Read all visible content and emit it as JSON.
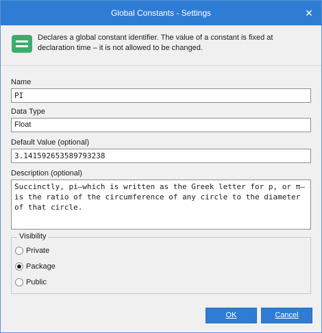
{
  "window": {
    "title": "Global Constants - Settings",
    "close_glyph": "✕"
  },
  "info": {
    "icon": "constant-icon",
    "icon_color": "#3cae6c",
    "text": "Declares a global constant identifier. The value of a constant is fixed at declaration time – it is not allowed to be changed."
  },
  "form": {
    "name_label": "Name",
    "name_value": "PI",
    "data_type_label": "Data Type",
    "data_type_value": "Float",
    "default_label": "Default Value (optional)",
    "default_value": "3.141592653589793238",
    "description_label": "Description (optional)",
    "description_value": "Succinctly, pi—which is written as the Greek letter for p, or π—is the ratio of the circumference of any circle to the diameter of that circle."
  },
  "visibility": {
    "title": "Visibility",
    "options": [
      {
        "label": "Private",
        "selected": false
      },
      {
        "label": "Package",
        "selected": true
      },
      {
        "label": "Public",
        "selected": false
      }
    ]
  },
  "buttons": {
    "ok": "OK",
    "cancel": "Cancel"
  },
  "colors": {
    "titlebar": "#2f7cd4",
    "accent": "#2f7cd4"
  }
}
